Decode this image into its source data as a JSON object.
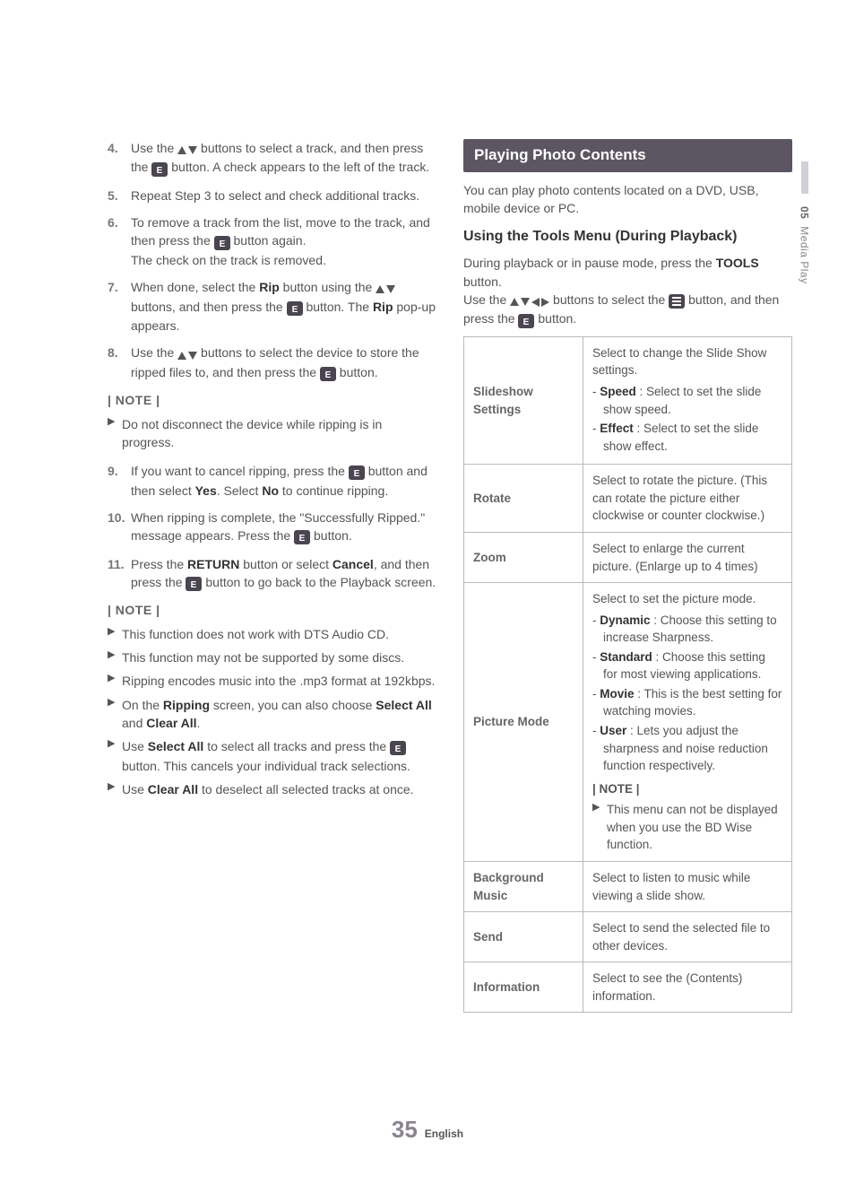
{
  "side_tab": {
    "num": "05",
    "label": "Media Play"
  },
  "left": {
    "steps_a": [
      {
        "n": "4.",
        "html": "Use the {UD} buttons to select a track, and then press the {E} button. A check appears to the left of the track."
      },
      {
        "n": "5.",
        "html": "Repeat Step 3 to select and check additional tracks."
      },
      {
        "n": "6.",
        "html": "To remove a track from the list, move to the track, and then press the {E} button again.<br>The check on the track is removed."
      },
      {
        "n": "7.",
        "html": "When done, select the <b>Rip</b> button using the {UD} buttons, and then press the {E} button. The <b>Rip</b> pop-up appears."
      },
      {
        "n": "8.",
        "html": "Use the {UD} buttons to select the device to store the ripped files to, and then press the {E} button."
      }
    ],
    "note1_label": "| NOTE |",
    "note1": [
      "Do not disconnect the device while ripping is in progress."
    ],
    "steps_b": [
      {
        "n": "9.",
        "html": "If you want to cancel ripping, press the {E} button and then select <b>Yes</b>. Select <b>No</b> to continue ripping."
      },
      {
        "n": "10.",
        "html": "When ripping is complete, the \"Successfully Ripped.\" message appears. Press the {E} button."
      },
      {
        "n": "11.",
        "html": "Press the <b>RETURN</b> button or select <b>Cancel</b>, and then press the {E} button to go back to the Playback screen."
      }
    ],
    "note2_label": "| NOTE |",
    "note2": [
      "This function does not work with DTS Audio CD.",
      "This function may not be supported by some discs.",
      "Ripping encodes music into the .mp3 format at 192kbps.",
      "On the <b>Ripping</b> screen, you can also choose <b>Select All</b> and <b>Clear All</b>.",
      "Use <b>Select All</b> to select all tracks and press the {E} button. This cancels your individual track selections.",
      "Use <b>Clear All</b> to deselect all selected tracks at once."
    ]
  },
  "right": {
    "bar": "Playing Photo Contents",
    "intro": "You can play photo contents located on a DVD, USB, mobile device or PC.",
    "sub": "Using the Tools Menu (During Playback)",
    "para_html": "During playback or in pause mode, press the <b>TOOLS</b> button.<br>Use the {UDLR} buttons to select the {T} button, and then press the {E} button.",
    "table": [
      {
        "k": "Slideshow Settings",
        "v_intro": "Select to change the Slide Show settings.",
        "v_items": [
          "<b>Speed</b> : Select to set the slide show speed.",
          "<b>Effect</b> : Select to set the slide show effect."
        ]
      },
      {
        "k": "Rotate",
        "v": "Select to rotate the picture. (This can rotate the picture either clockwise or counter clockwise.)"
      },
      {
        "k": "Zoom",
        "v": "Select to enlarge the current picture. (Enlarge up to 4 times)"
      },
      {
        "k": "Picture Mode",
        "v_intro": "Select to set the picture mode.",
        "v_items": [
          "<b>Dynamic</b> : Choose this setting to increase Sharpness.",
          "<b>Standard</b> : Choose this setting for most viewing applications.",
          "<b>Movie</b> : This is the best setting for watching movies.",
          "<b>User</b> : Lets you adjust the sharpness and noise reduction function respectively."
        ],
        "note_label": "| NOTE |",
        "note": "This menu can not be displayed when you use the BD Wise function."
      },
      {
        "k": "Background Music",
        "v": "Select to listen to music while viewing a slide show."
      },
      {
        "k": "Send",
        "v": "Select to send the selected file to other devices."
      },
      {
        "k": "Information",
        "v": "Select to see the (Contents) information."
      }
    ]
  },
  "footer": {
    "page": "35",
    "lang": "English"
  }
}
